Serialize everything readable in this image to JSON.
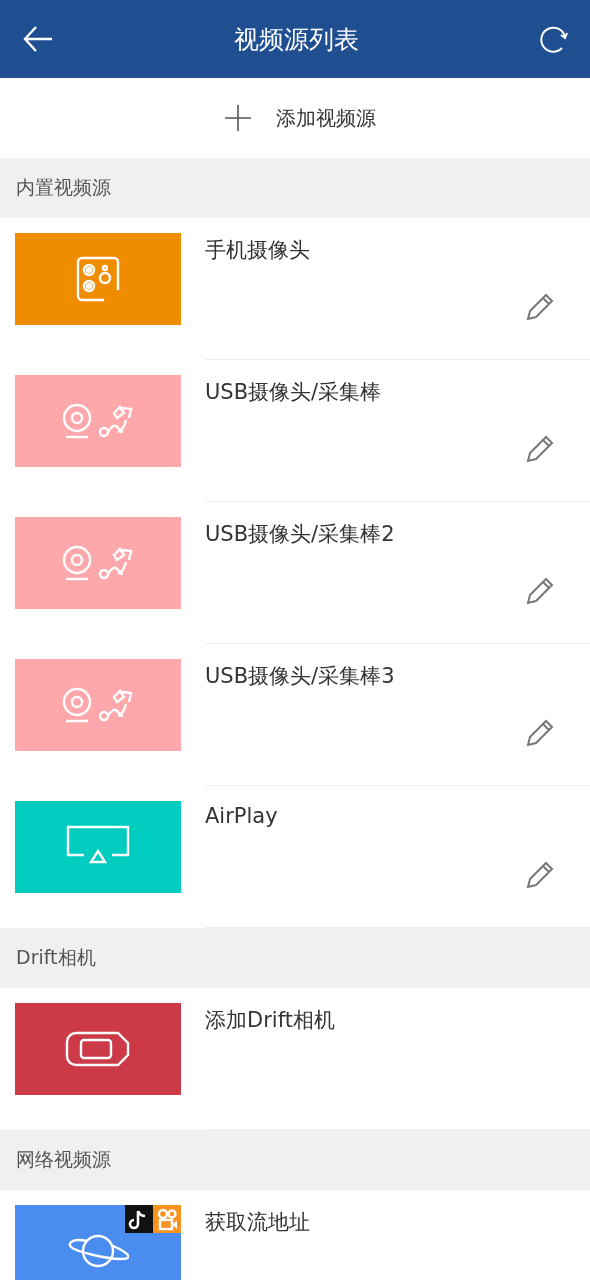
{
  "app_bar": {
    "title": "视频源列表"
  },
  "add_button": {
    "label": "添加视频源"
  },
  "sections": [
    {
      "title": "内置视频源",
      "items": [
        {
          "name": "手机摄像头",
          "kind": "phone",
          "color": "#f08c00",
          "editable": true
        },
        {
          "name": "USB摄像头/采集棒",
          "kind": "usb",
          "color": "#ffa8ab",
          "editable": true
        },
        {
          "name": "USB摄像头/采集棒2",
          "kind": "usb",
          "color": "#ffa8ab",
          "editable": true
        },
        {
          "name": "USB摄像头/采集棒3",
          "kind": "usb",
          "color": "#ffa8ab",
          "editable": true
        },
        {
          "name": "AirPlay",
          "kind": "airplay",
          "color": "#00ccc0",
          "editable": true
        }
      ]
    },
    {
      "title": "Drift相机",
      "items": [
        {
          "name": "添加Drift相机",
          "kind": "drift",
          "color": "#cc3a47",
          "editable": false
        }
      ]
    },
    {
      "title": "网络视频源",
      "items": [
        {
          "name": "获取流地址",
          "kind": "network",
          "color": "#4a8cf0",
          "editable": false
        }
      ]
    }
  ]
}
